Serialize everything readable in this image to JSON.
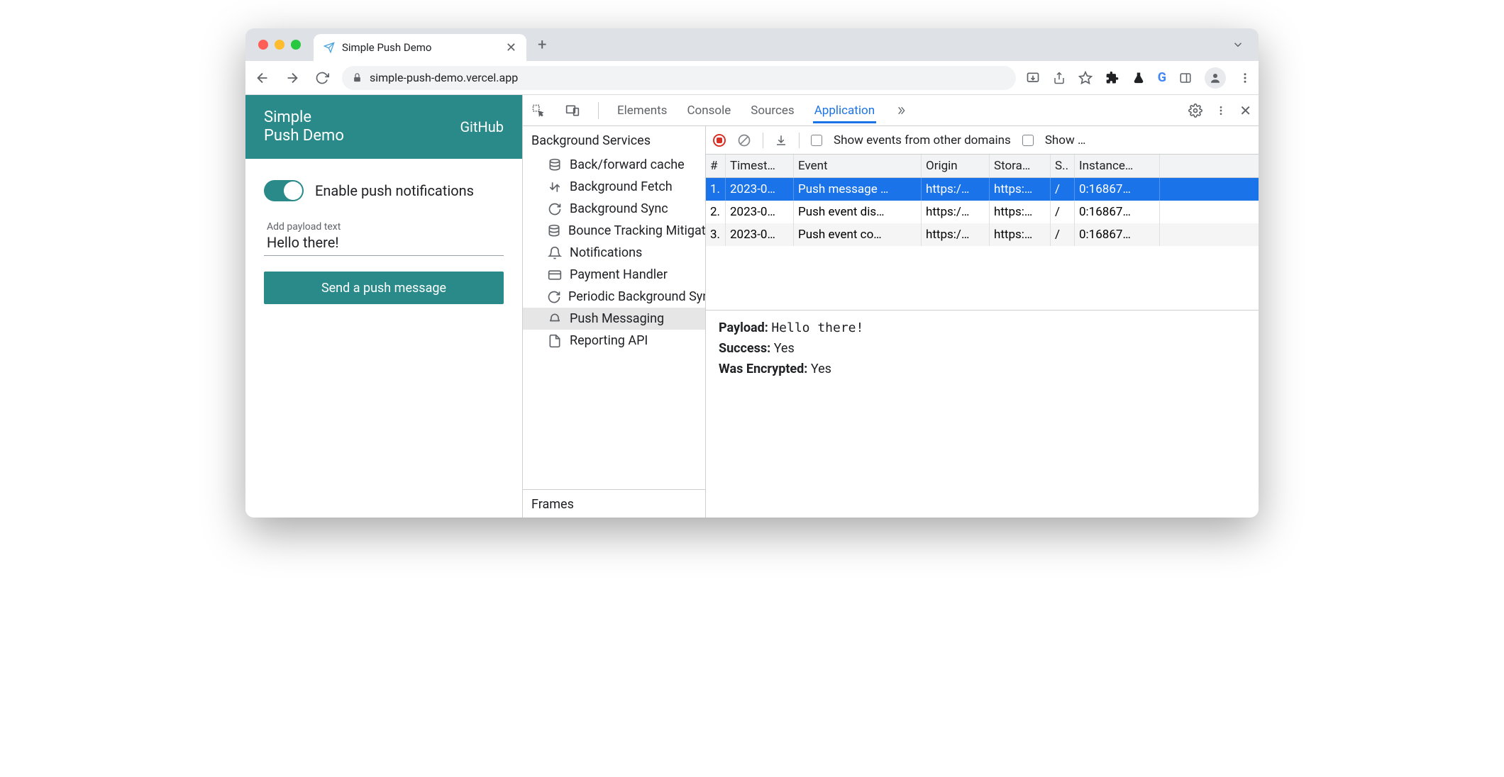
{
  "browser": {
    "tab_title": "Simple Push Demo",
    "url": "simple-push-demo.vercel.app"
  },
  "page": {
    "title_line1": "Simple",
    "title_line2": "Push Demo",
    "github_label": "GitHub",
    "toggle_label": "Enable push notifications",
    "payload_placeholder": "Add payload text",
    "payload_value": "Hello there!",
    "send_button": "Send a push message"
  },
  "devtools": {
    "tabs": [
      "Elements",
      "Console",
      "Sources",
      "Application"
    ],
    "active_tab": "Application",
    "sidebar": {
      "section1": "Background Services",
      "items": [
        "Back/forward cache",
        "Background Fetch",
        "Background Sync",
        "Bounce Tracking Mitigations",
        "Notifications",
        "Payment Handler",
        "Periodic Background Sync",
        "Push Messaging",
        "Reporting API"
      ],
      "selected": "Push Messaging",
      "section2": "Frames"
    },
    "toolbar": {
      "show_other_domains": "Show events from other domains",
      "show_truncated": "Show …"
    },
    "table": {
      "headers": [
        "#",
        "Timest…",
        "Event",
        "Origin",
        "Stora…",
        "S..",
        "Instance…"
      ],
      "rows": [
        {
          "n": "1.",
          "ts": "2023-0…",
          "event": "Push message …",
          "origin": "https:/…",
          "storage": "https:…",
          "sw": "/",
          "instance": "0:16867…",
          "selected": true
        },
        {
          "n": "2.",
          "ts": "2023-0…",
          "event": "Push event dis…",
          "origin": "https:/…",
          "storage": "https:…",
          "sw": "/",
          "instance": "0:16867…",
          "selected": false
        },
        {
          "n": "3.",
          "ts": "2023-0…",
          "event": "Push event co…",
          "origin": "https:/…",
          "storage": "https:…",
          "sw": "/",
          "instance": "0:16867…",
          "selected": false
        }
      ]
    },
    "detail": {
      "payload_label": "Payload:",
      "payload_value": "Hello there!",
      "success_label": "Success:",
      "success_value": "Yes",
      "encrypted_label": "Was Encrypted:",
      "encrypted_value": "Yes"
    }
  }
}
